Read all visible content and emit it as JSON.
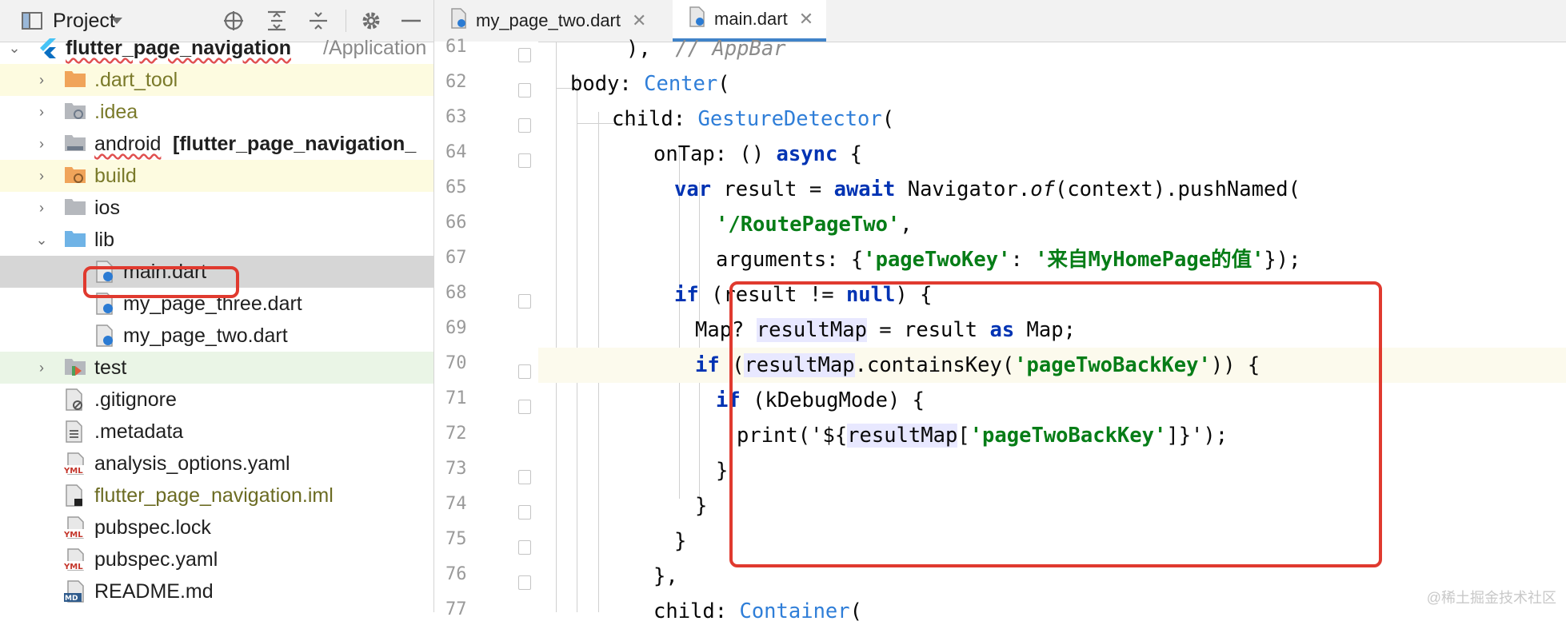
{
  "project_panel": {
    "title": "Project",
    "tree": [
      {
        "label": "flutter_page_navigation",
        "suffix": "/Application",
        "expanded": true
      },
      {
        "label": ".dart_tool"
      },
      {
        "label": ".idea"
      },
      {
        "label": "android",
        "suffix": "[flutter_page_navigation_"
      },
      {
        "label": "build"
      },
      {
        "label": "ios"
      },
      {
        "label": "lib",
        "expanded": true
      },
      {
        "label": "main.dart"
      },
      {
        "label": "my_page_three.dart"
      },
      {
        "label": "my_page_two.dart"
      },
      {
        "label": "test"
      },
      {
        "label": ".gitignore"
      },
      {
        "label": ".metadata"
      },
      {
        "label": "analysis_options.yaml"
      },
      {
        "label": "flutter_page_navigation.iml"
      },
      {
        "label": "pubspec.lock"
      },
      {
        "label": "pubspec.yaml"
      },
      {
        "label": "README.md"
      }
    ]
  },
  "editor": {
    "tabs": [
      {
        "label": "my_page_two.dart",
        "active": false
      },
      {
        "label": "main.dart",
        "active": true
      }
    ],
    "line_numbers": [
      "61",
      "62",
      "63",
      "64",
      "65",
      "66",
      "67",
      "68",
      "69",
      "70",
      "71",
      "72",
      "73",
      "74",
      "75",
      "76",
      "77"
    ],
    "current_line": "70",
    "code": {
      "l61_a": "),  ",
      "l61_b": "// AppBar",
      "l62_a": "body: ",
      "l62_b": "Center",
      "l62_c": "(",
      "l63_a": "child: ",
      "l63_b": "GestureDetector",
      "l63_c": "(",
      "l64_a": "onTap: () ",
      "l64_b": "async",
      "l64_c": " {",
      "l65_a": "var",
      "l65_b": " result = ",
      "l65_c": "await",
      "l65_d": " Navigator.",
      "l65_e": "of",
      "l65_f": "(context).pushNamed(",
      "l66_a": "'/RoutePageTwo'",
      "l66_b": ",",
      "l67_a": "arguments: {",
      "l67_b": "'pageTwoKey'",
      "l67_c": ": ",
      "l67_d": "'来自MyHomePage的值'",
      "l67_e": "});",
      "l68_a": "if",
      "l68_b": " (result != ",
      "l68_c": "null",
      "l68_d": ") {",
      "l69_a": "Map? ",
      "l69_b": "resultMap",
      "l69_c": " = result ",
      "l69_d": "as",
      "l69_e": " Map;",
      "l70_a": "if",
      "l70_b": " (",
      "l70_c": "resultMap",
      "l70_d": ".containsKey(",
      "l70_e": "'pageTwoBackKey'",
      "l70_f": ")) {",
      "l71_a": "if",
      "l71_b": " (kDebugMode) {",
      "l72_a": "print('${",
      "l72_b": "resultMap",
      "l72_c": "[",
      "l72_d": "'pageTwoBackKey'",
      "l72_e": "]}');",
      "l73": "}",
      "l74": "}",
      "l75": "}",
      "l76": "},",
      "l77_a": "child: ",
      "l77_b": "Container",
      "l77_c": "("
    }
  },
  "watermark": "@稀土掘金技术社区",
  "colors": {
    "keyword": "#0033b3",
    "class": "#2f7ed8",
    "string": "#067d17",
    "comment": "#8c8c8c",
    "annotation_box": "#e03a2f",
    "tab_underline": "#4083c9"
  }
}
